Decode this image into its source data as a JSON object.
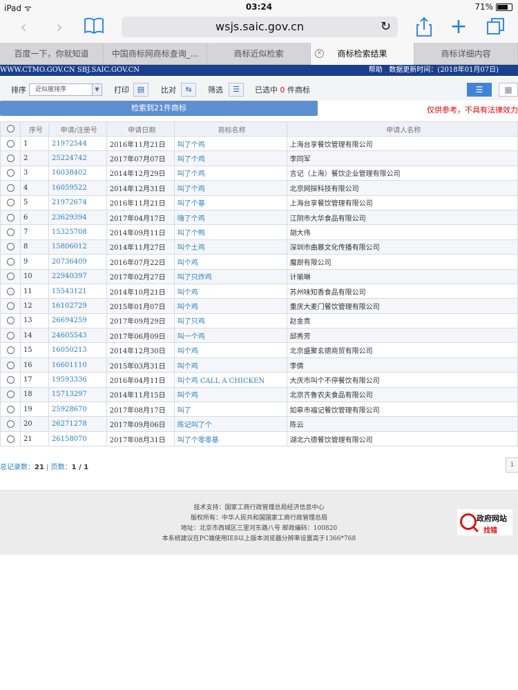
{
  "status": {
    "device": "iPad",
    "time": "03:24",
    "battery": "71%"
  },
  "browser": {
    "url": "wsjs.saic.gov.cn"
  },
  "tabs": [
    {
      "label": "百度一下，你就知道"
    },
    {
      "label": "中国商标网商标查询_..."
    },
    {
      "label": "商标近似检索"
    },
    {
      "label": "商标检索结果"
    },
    {
      "label": "商标详细内容"
    }
  ],
  "site": {
    "domains": "WWW.CTMO.GOV.CN SBJ.SAIC.GOV.CN",
    "help": "帮助",
    "update_label": "数据更新时间：(2018年01月07日)"
  },
  "controls": {
    "sort_label": "排序",
    "sort_value": "近似度排序",
    "print_label": "打印",
    "compare_label": "比对",
    "filter_label": "筛选",
    "selected_prefix": "已选中",
    "selected_count": "0",
    "selected_suffix": "件商标"
  },
  "result": {
    "summary": "检索到21件商标",
    "disclaimer": "仅供参考，不具有法律效力"
  },
  "table": {
    "headers": [
      "序号",
      "申请/注册号",
      "申请日期",
      "商标名称",
      "申请人名称"
    ],
    "rows": [
      {
        "no": "1",
        "reg": "21972544",
        "date": "2016年11月21日",
        "name": "叫了个鸡",
        "applicant": "上海台享餐饮管理有限公司"
      },
      {
        "no": "2",
        "reg": "25224742",
        "date": "2017年07月07日",
        "name": "叫了个鸡",
        "applicant": "李同军"
      },
      {
        "no": "3",
        "reg": "16038402",
        "date": "2014年12月29日",
        "name": "叫了个鸡",
        "applicant": "言记（上海）餐饮企业管理有限公司"
      },
      {
        "no": "4",
        "reg": "16059522",
        "date": "2014年12月31日",
        "name": "叫了个鸡",
        "applicant": "北京网探科技有限公司"
      },
      {
        "no": "5",
        "reg": "21972674",
        "date": "2016年11月21日",
        "name": "叫了个基",
        "applicant": "上海台享餐饮管理有限公司"
      },
      {
        "no": "6",
        "reg": "23629394",
        "date": "2017年04月17日",
        "name": "嗨了个鸡",
        "applicant": "江阴市大华食品有限公司"
      },
      {
        "no": "7",
        "reg": "15325708",
        "date": "2014年09月11日",
        "name": "叫了个鸭",
        "applicant": "胡大伟"
      },
      {
        "no": "8",
        "reg": "15806012",
        "date": "2014年11月27日",
        "name": "叫个土鸡",
        "applicant": "深圳市曲慕文化传播有限公司"
      },
      {
        "no": "9",
        "reg": "20736409",
        "date": "2016年07月22日",
        "name": "叫个鸡",
        "applicant": "魔厨有限公司"
      },
      {
        "no": "10",
        "reg": "22940397",
        "date": "2017年02月27日",
        "name": "叫了只炸鸡",
        "applicant": "计瑜琳"
      },
      {
        "no": "11",
        "reg": "15543121",
        "date": "2014年10月21日",
        "name": "叫个鸡",
        "applicant": "苏州味知香食品有限公司"
      },
      {
        "no": "12",
        "reg": "16102729",
        "date": "2015年01月07日",
        "name": "叫个鸡",
        "applicant": "重庆大麦门餐饮管理有限公司"
      },
      {
        "no": "13",
        "reg": "26694259",
        "date": "2017年09月29日",
        "name": "叫了只鸡",
        "applicant": "赵金贵"
      },
      {
        "no": "14",
        "reg": "24605543",
        "date": "2017年06月09日",
        "name": "叫一个鸡",
        "applicant": "邱秀芳"
      },
      {
        "no": "15",
        "reg": "16050213",
        "date": "2014年12月30日",
        "name": "叫个鸡",
        "applicant": "北京盛聚玄德商贸有限公司"
      },
      {
        "no": "16",
        "reg": "16601110",
        "date": "2015年03月31日",
        "name": "叫个鸡",
        "applicant": "李倩"
      },
      {
        "no": "17",
        "reg": "19593336",
        "date": "2016年04月11日",
        "name": "叫个鸡 CALL A CHICKEN",
        "applicant": "大庆市叫个不停餐饮有限公司"
      },
      {
        "no": "18",
        "reg": "15713297",
        "date": "2014年11月15日",
        "name": "叫个鸡",
        "applicant": "北京齐鲁农夫食品有限公司"
      },
      {
        "no": "19",
        "reg": "25928670",
        "date": "2017年08月17日",
        "name": "叫了",
        "applicant": "如皋市福记餐饮管理有限公司"
      },
      {
        "no": "20",
        "reg": "26271278",
        "date": "2017年09月06日",
        "name": "陈记叫了个",
        "applicant": "陈云"
      },
      {
        "no": "21",
        "reg": "26158070",
        "date": "2017年08月31日",
        "name": "叫了个零零基",
        "applicant": "湖北六德餐饮管理有限公司"
      }
    ]
  },
  "pager": {
    "total_label": "总记录数：",
    "total": "21",
    "sep": " | ",
    "pages_label": "页数：",
    "pages": "1 / 1",
    "box": "1"
  },
  "footer": {
    "lines": [
      "技术支持：国家工商行政管理总局经济信息中心",
      "版权所有：中华人民共和国国家工商行政管理总局",
      "地址：北京市西城区三里河东路八号  邮政编码：100820",
      "本系统建议在PC端使用IE8以上版本浏览器分辨率设置高于1366*768"
    ],
    "badge_title": "政府网站",
    "badge_sub": "找错"
  }
}
